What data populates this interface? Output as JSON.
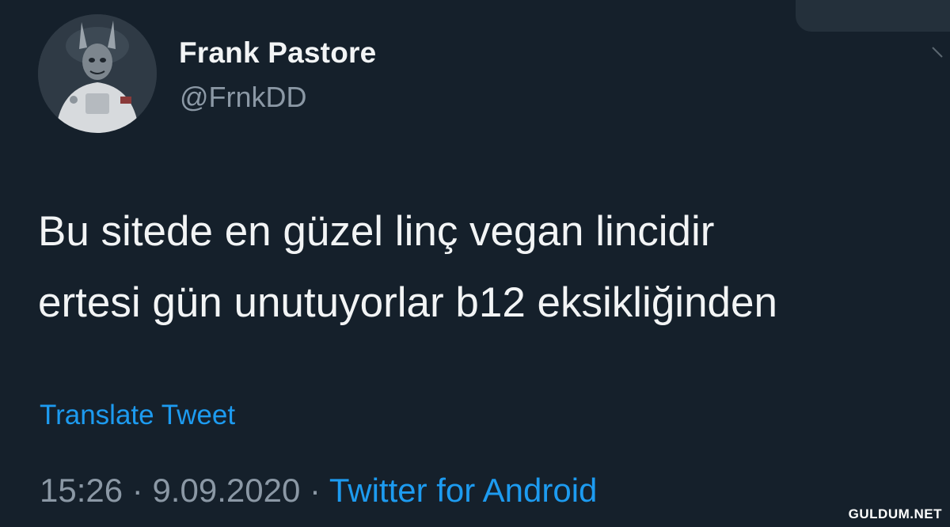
{
  "tweet": {
    "author_name": "Frank Pastore",
    "author_handle": "@FrnkDD",
    "text_lines": [
      "Bu sitede en güzel linç vegan lincidir",
      "ertesi gün unutuyorlar b12 eksikliğinden"
    ],
    "translate_label": "Translate Tweet",
    "time": "15:26",
    "date": "9.09.2020",
    "separator": "·",
    "source": "Twitter for Android"
  },
  "watermark": "GULDUM.NET",
  "icons": {
    "avatar": "astronaut-avatar",
    "menu": "chevron-down-icon"
  },
  "colors": {
    "background": "#15202b",
    "accent": "#1d9bf0",
    "secondary_text": "#8b98a5"
  }
}
